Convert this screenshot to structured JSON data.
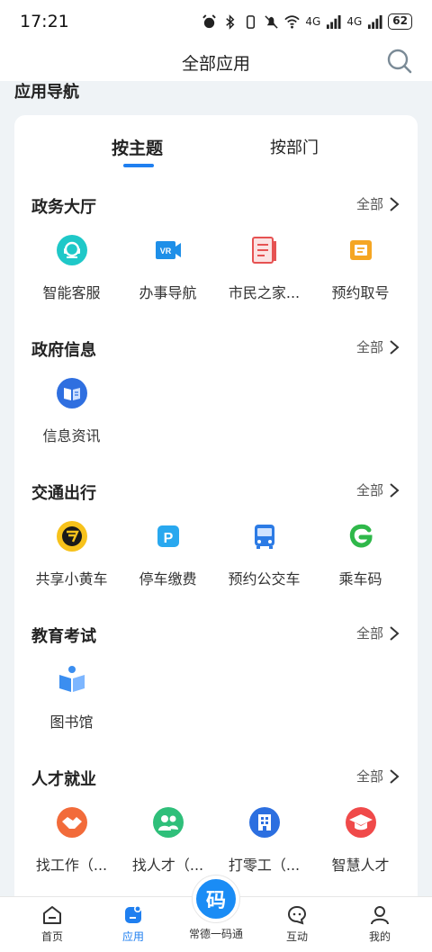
{
  "status": {
    "time": "17:21",
    "net1": "4G",
    "net2": "4G",
    "battery": "62"
  },
  "header": {
    "title": "全部应用"
  },
  "section": {
    "title": "应用导航"
  },
  "tabs": [
    {
      "label": "按主题"
    },
    {
      "label": "按部门"
    }
  ],
  "more_label": "全部",
  "groups": [
    {
      "title": "政务大厅",
      "items": [
        {
          "label": "智能客服",
          "icon": "customer-service-icon"
        },
        {
          "label": "办事导航",
          "icon": "vr-navigation-icon"
        },
        {
          "label": "市民之家...",
          "icon": "citizen-home-icon"
        },
        {
          "label": "预约取号",
          "icon": "appointment-ticket-icon"
        }
      ]
    },
    {
      "title": "政府信息",
      "items": [
        {
          "label": "信息资讯",
          "icon": "news-book-icon"
        }
      ]
    },
    {
      "title": "交通出行",
      "items": [
        {
          "label": "共享小黄车",
          "icon": "shared-bike-icon"
        },
        {
          "label": "停车缴费",
          "icon": "parking-icon"
        },
        {
          "label": "预约公交车",
          "icon": "bus-icon"
        },
        {
          "label": "乘车码",
          "icon": "ride-code-icon"
        }
      ]
    },
    {
      "title": "教育考试",
      "items": [
        {
          "label": "图书馆",
          "icon": "library-icon"
        }
      ]
    },
    {
      "title": "人才就业",
      "items": [
        {
          "label": "找工作（...",
          "icon": "handshake-icon"
        },
        {
          "label": "找人才（...",
          "icon": "people-icon"
        },
        {
          "label": "打零工（...",
          "icon": "building-icon"
        },
        {
          "label": "智慧人才",
          "icon": "graduation-cap-icon"
        }
      ]
    }
  ],
  "nav": [
    {
      "label": "首页"
    },
    {
      "label": "应用"
    },
    {
      "label": "常德一码通",
      "center_glyph": "码"
    },
    {
      "label": "互动"
    },
    {
      "label": "我的"
    }
  ],
  "colors": {
    "accent": "#1f7ff0",
    "background": "#eff3f6"
  }
}
